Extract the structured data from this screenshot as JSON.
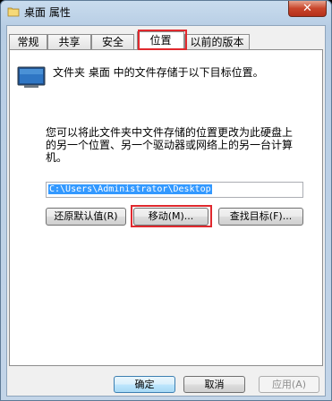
{
  "window": {
    "title": "桌面 属性",
    "close_label": "✕"
  },
  "tabs": [
    {
      "label": "常规"
    },
    {
      "label": "共享"
    },
    {
      "label": "安全"
    },
    {
      "label": "位置"
    },
    {
      "label": "以前的版本"
    }
  ],
  "active_tab": "位置",
  "location": {
    "info_text": "文件夹 桌面 中的文件存储于以下目标位置。",
    "description_lines": [
      "您可以将此文件夹中文件存储的位置更改为此硬盘上",
      "的另一个位置、另一个驱动器或网络上的另一台计算",
      "机。"
    ],
    "path_value": "C:\\Users\\Administrator\\Desktop",
    "restore_default_label": "还原默认值(R)",
    "move_label": "移动(M)...",
    "find_target_label": "查找目标(F)..."
  },
  "footer": {
    "ok_label": "确定",
    "cancel_label": "取消",
    "apply_label": "应用(A)"
  },
  "colors": {
    "highlight": "#e0292e",
    "selection": "#3399ff",
    "close_button": "#c8452b"
  }
}
